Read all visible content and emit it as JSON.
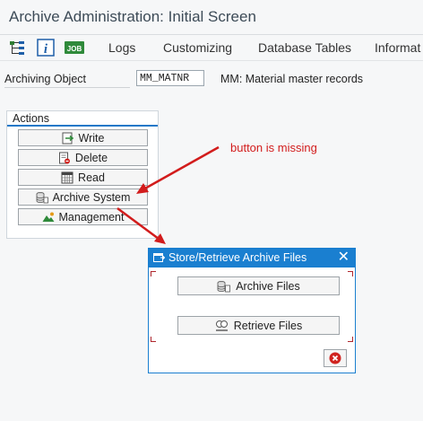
{
  "window": {
    "title": "Archive Administration: Initial Screen"
  },
  "toolbar": {
    "icons": [
      "hierarchy-icon",
      "info-icon",
      "job-icon"
    ],
    "job_label": "JOB",
    "menu": [
      "Logs",
      "Customizing",
      "Database Tables",
      "Informat"
    ]
  },
  "archiving_object": {
    "label": "Archiving Object",
    "value": "MM_MATNR",
    "description": "MM: Material master records"
  },
  "actions": {
    "title": "Actions",
    "buttons": [
      "Write",
      "Delete",
      "Read",
      "Archive System",
      "Management"
    ]
  },
  "annotation": {
    "text": "button is missing",
    "color": "#d21c1c"
  },
  "dialog": {
    "title": "Store/Retrieve Archive Files",
    "close_label": "✕",
    "buttons": [
      "Archive Files",
      "Retrieve Files"
    ]
  },
  "colors": {
    "accent": "#1a7fd0",
    "annotation": "#d21c1c"
  }
}
